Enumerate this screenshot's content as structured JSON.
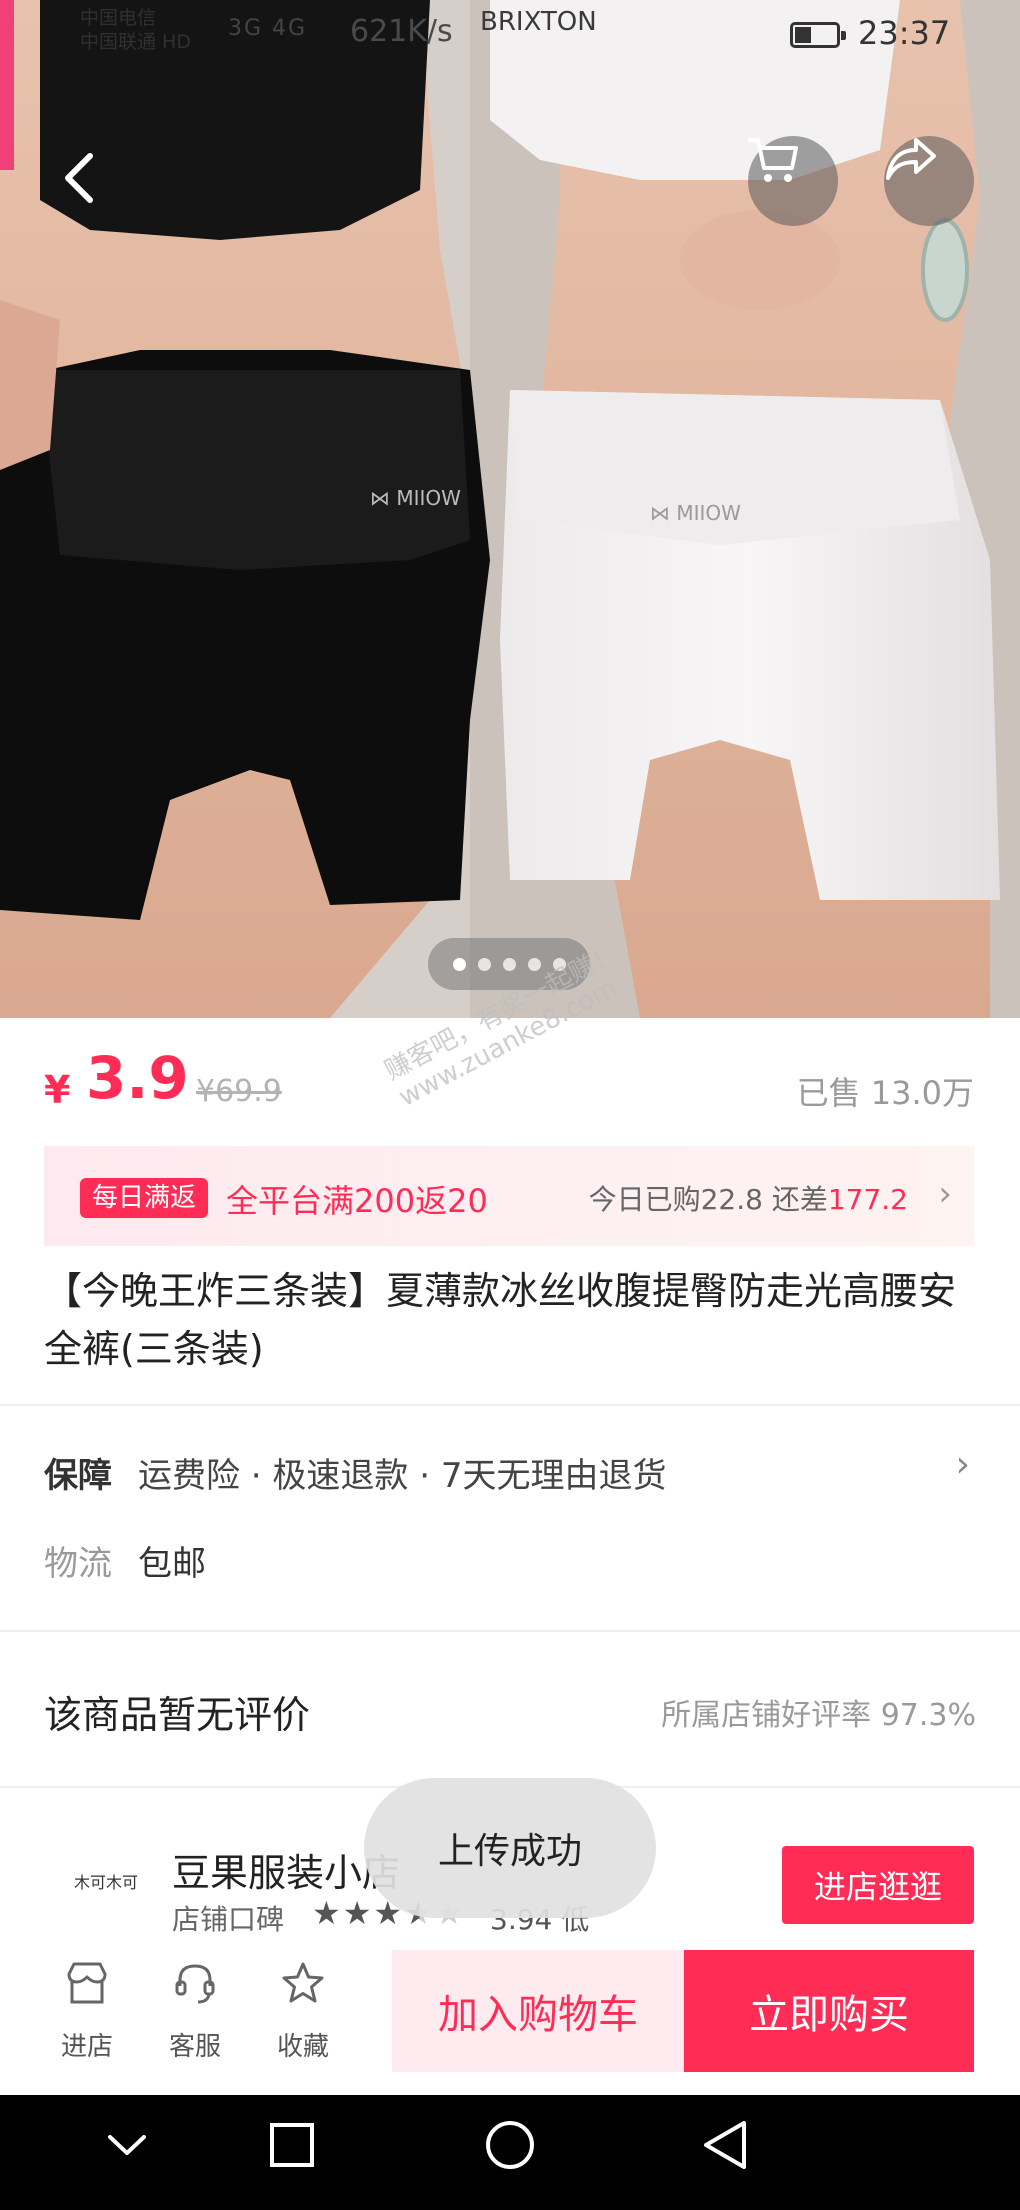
{
  "status_bar": {
    "carrier_1": "中国电信",
    "carrier_2": "中国联通 HD",
    "signal": "3G 4G",
    "speed": "621K/s",
    "time": "23:37"
  },
  "hero": {
    "image_count": 5,
    "active_index": 0
  },
  "price": {
    "currency": "¥",
    "current": "3.9",
    "original": "¥69.9",
    "sold": "已售 13.0万"
  },
  "watermark": {
    "line1": "赚客吧，有奖一起赚！",
    "line2": "www.zuanke8.com"
  },
  "promo": {
    "tag": "每日满返",
    "text": "全平台满200返20",
    "today_prefix": "今日已购22.8 还差",
    "remaining": "177.2"
  },
  "product": {
    "title": "【今晚王炸三条装】夏薄款冰丝收腹提臀防走光高腰安全裤(三条装)"
  },
  "service": {
    "guarantee_label": "保障",
    "guarantee_value": "运费险 · 极速退款 · 7天无理由退货",
    "logistics_label": "物流",
    "logistics_value": "包邮"
  },
  "review": {
    "title": "该商品暂无评价",
    "shop_rate": "所属店铺好评率 97.3%"
  },
  "shop": {
    "logo_text": "木可木可",
    "name": "豆果服装小店",
    "rating_label": "店铺口碑",
    "score": "3.94",
    "score_level": "低",
    "stars": 3.5,
    "visit_label": "进店逛逛"
  },
  "toast": {
    "message": "上传成功"
  },
  "bottom_bar": {
    "tab_store": "进店",
    "tab_service": "客服",
    "tab_favorite": "收藏",
    "add_cart": "加入购物车",
    "buy_now": "立即购买"
  },
  "colors": {
    "accent": "#ff2d55",
    "promo_bg": "#fdebef"
  }
}
